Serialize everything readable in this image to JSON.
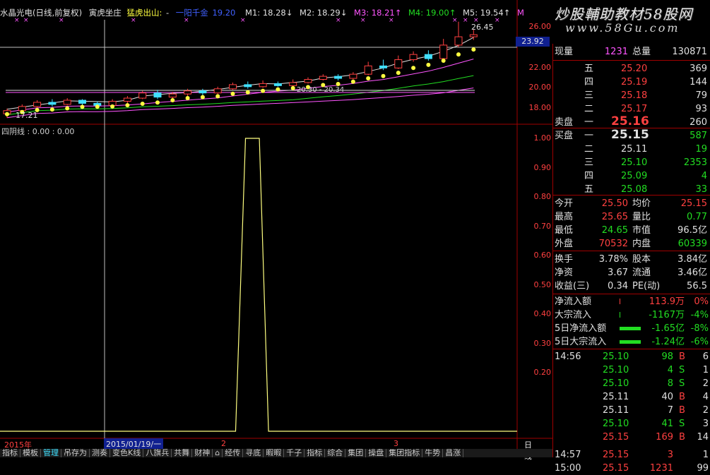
{
  "header": {
    "stock_title": "水晶光电(日线,前复权)",
    "signal1": "寅虎坐庄",
    "signal2": "猛虎出山:",
    "ind_sep": "-",
    "mline0": "一阳千金",
    "mline0_val": "19.20",
    "m1": "M1: 18.28↓",
    "m2": "M2: 18.29↓",
    "m3": "M3: 18.21↑",
    "m4": "M4: 19.00↑",
    "m5": "M5: 19.54↑",
    "m6": "M",
    "colors": {
      "title": "#e0e0e0",
      "signal1": "#e0e0e0",
      "signal2": "#ffff40",
      "m0": "#4060ff",
      "m1": "#e0e0e0",
      "m2": "#e0e0e0",
      "m3": "#ff55ff",
      "m4": "#22dd22",
      "m5": "#e0e0e0"
    }
  },
  "watermark": {
    "line1": "炒股輔助教材58股网",
    "line2": "www.58Gu.com"
  },
  "price_axis": {
    "ticks": [
      "26.00",
      "24.00",
      "22.00",
      "20.00",
      "18.00"
    ],
    "current": "23.92"
  },
  "annotations": {
    "high": "26.45",
    "low": "17.21",
    "mid": "20.30 - 20.34"
  },
  "indicator": {
    "label": "四阴线 : 0.00 : 0.00",
    "ticks": [
      "1.00",
      "0.90",
      "0.80",
      "0.70",
      "0.60",
      "0.50",
      "0.40",
      "0.30",
      "0.20"
    ],
    "spike": {
      "start_index": 15,
      "end_index": 17,
      "value": 1.0
    }
  },
  "x_axis": {
    "year": "2015年",
    "date_cursor": "2015/01/19/一",
    "m2": "2",
    "m3": "3",
    "period": "日线"
  },
  "chart_data": {
    "type": "candlestick",
    "candles": [
      {
        "o": 17.6,
        "c": 17.9,
        "h": 18.1,
        "l": 17.21
      },
      {
        "o": 17.9,
        "c": 18.3,
        "h": 18.5,
        "l": 17.8
      },
      {
        "o": 18.3,
        "c": 18.7,
        "h": 18.9,
        "l": 18.1
      },
      {
        "o": 18.7,
        "c": 18.5,
        "h": 19.0,
        "l": 18.3
      },
      {
        "o": 18.5,
        "c": 18.9,
        "h": 19.1,
        "l": 18.4
      },
      {
        "o": 18.9,
        "c": 18.6,
        "h": 19.0,
        "l": 18.3
      },
      {
        "o": 18.6,
        "c": 18.4,
        "h": 18.8,
        "l": 18.1
      },
      {
        "o": 18.4,
        "c": 18.8,
        "h": 19.0,
        "l": 18.3
      },
      {
        "o": 18.8,
        "c": 19.1,
        "h": 19.3,
        "l": 18.6
      },
      {
        "o": 19.1,
        "c": 19.6,
        "h": 19.8,
        "l": 19.0
      },
      {
        "o": 19.6,
        "c": 19.2,
        "h": 19.9,
        "l": 19.0
      },
      {
        "o": 19.2,
        "c": 19.5,
        "h": 19.7,
        "l": 19.0
      },
      {
        "o": 19.5,
        "c": 19.8,
        "h": 20.0,
        "l": 19.3
      },
      {
        "o": 19.8,
        "c": 19.6,
        "h": 20.0,
        "l": 19.4
      },
      {
        "o": 19.6,
        "c": 20.0,
        "h": 20.2,
        "l": 19.5
      },
      {
        "o": 20.0,
        "c": 20.4,
        "h": 20.6,
        "l": 19.9
      },
      {
        "o": 20.4,
        "c": 20.2,
        "h": 20.7,
        "l": 20.0
      },
      {
        "o": 20.2,
        "c": 20.5,
        "h": 20.8,
        "l": 20.1
      },
      {
        "o": 20.5,
        "c": 20.3,
        "h": 20.7,
        "l": 20.2
      },
      {
        "o": 20.3,
        "c": 20.6,
        "h": 20.9,
        "l": 20.2
      },
      {
        "o": 20.6,
        "c": 20.9,
        "h": 21.1,
        "l": 20.5
      },
      {
        "o": 20.9,
        "c": 21.2,
        "h": 21.4,
        "l": 20.8
      },
      {
        "o": 21.2,
        "c": 21.0,
        "h": 21.4,
        "l": 20.8
      },
      {
        "o": 21.0,
        "c": 21.4,
        "h": 21.6,
        "l": 20.9
      },
      {
        "o": 21.4,
        "c": 22.2,
        "h": 22.6,
        "l": 21.3
      },
      {
        "o": 22.2,
        "c": 22.0,
        "h": 22.8,
        "l": 21.8
      },
      {
        "o": 22.0,
        "c": 22.8,
        "h": 23.2,
        "l": 21.9
      },
      {
        "o": 22.8,
        "c": 23.3,
        "h": 23.6,
        "l": 22.6
      },
      {
        "o": 23.3,
        "c": 22.9,
        "h": 23.7,
        "l": 22.7
      },
      {
        "o": 22.9,
        "c": 24.2,
        "h": 24.8,
        "l": 22.8
      },
      {
        "o": 24.2,
        "c": 25.0,
        "h": 26.45,
        "l": 24.0
      },
      {
        "o": 25.0,
        "c": 25.2,
        "h": 25.7,
        "l": 24.7
      }
    ],
    "ylim": [
      17,
      26.5
    ]
  },
  "quote": {
    "now_vol_label": "现量",
    "now_vol": "1231",
    "total_vol_label": "总量",
    "total_vol": "130871",
    "sells": [
      {
        "label": "五",
        "price": "25.20",
        "vol": "369"
      },
      {
        "label": "四",
        "price": "25.19",
        "vol": "144"
      },
      {
        "label": "三",
        "price": "25.18",
        "vol": "79"
      },
      {
        "label": "二",
        "price": "25.17",
        "vol": "93"
      },
      {
        "label": "卖盘 一",
        "price": "25.16",
        "vol": "260"
      }
    ],
    "buys": [
      {
        "label": "买盘 一",
        "price": "25.15",
        "vol": "587"
      },
      {
        "label": "二",
        "price": "25.11",
        "vol": "19"
      },
      {
        "label": "三",
        "price": "25.10",
        "vol": "2353"
      },
      {
        "label": "四",
        "price": "25.09",
        "vol": "4"
      },
      {
        "label": "五",
        "price": "25.08",
        "vol": "33"
      }
    ],
    "stats": [
      {
        "l1": "今开",
        "v1": "25.50",
        "l2": "均价",
        "v2": "25.15",
        "c1": "r",
        "c2": "r"
      },
      {
        "l1": "最高",
        "v1": "25.65",
        "l2": "量比",
        "v2": "0.77",
        "c1": "r",
        "c2": "g"
      },
      {
        "l1": "最低",
        "v1": "24.65",
        "l2": "市值",
        "v2": "96.5亿",
        "c1": "g",
        "c2": "w"
      },
      {
        "l1": "外盘",
        "v1": "70532",
        "l2": "内盘",
        "v2": "60339",
        "c1": "r",
        "c2": "g"
      }
    ],
    "stats2": [
      {
        "l1": "换手",
        "v1": "3.78%",
        "l2": "股本",
        "v2": "3.84亿"
      },
      {
        "l1": "净资",
        "v1": "3.67",
        "l2": "流通",
        "v2": "3.46亿"
      },
      {
        "l1": "收益(三)",
        "v1": "0.34",
        "l2": "PE(动)",
        "v2": "56.5"
      }
    ],
    "flows": [
      {
        "label": "净流入额",
        "val": "113.9万",
        "pct": "0%",
        "c": "r",
        "bar": 0
      },
      {
        "label": "大宗流入",
        "val": "-1167万",
        "pct": "-4%",
        "c": "g",
        "bar": 0
      },
      {
        "label": "5日净流入额",
        "val": "-1.65亿",
        "pct": "-8%",
        "c": "g",
        "bar": 1
      },
      {
        "label": "5日大宗流入",
        "val": "-1.24亿",
        "pct": "-6%",
        "c": "g",
        "bar": 1
      }
    ],
    "ticks": [
      {
        "t": "14:56",
        "p": "25.10",
        "v": "98",
        "s": "B",
        "n": "6",
        "pc": "g",
        "sc": "r"
      },
      {
        "t": "",
        "p": "25.10",
        "v": "4",
        "s": "S",
        "n": "1",
        "pc": "g",
        "sc": "g"
      },
      {
        "t": "",
        "p": "25.10",
        "v": "8",
        "s": "S",
        "n": "2",
        "pc": "g",
        "sc": "g"
      },
      {
        "t": "",
        "p": "25.11",
        "v": "40",
        "s": "B",
        "n": "4",
        "pc": "w",
        "sc": "r"
      },
      {
        "t": "",
        "p": "25.11",
        "v": "7",
        "s": "B",
        "n": "2",
        "pc": "w",
        "sc": "r"
      },
      {
        "t": "",
        "p": "25.10",
        "v": "41",
        "s": "S",
        "n": "3",
        "pc": "g",
        "sc": "g"
      },
      {
        "t": "",
        "p": "25.15",
        "v": "169",
        "s": "B",
        "n": "14",
        "pc": "r",
        "sc": "r"
      },
      {
        "t": "14:57",
        "p": "25.15",
        "v": "3",
        "s": "",
        "n": "1",
        "pc": "r",
        "sc": "r"
      },
      {
        "t": "15:00",
        "p": "25.15",
        "v": "1231",
        "s": "",
        "n": "99",
        "pc": "r",
        "sc": "r"
      }
    ]
  },
  "tabs": [
    "指标",
    "模板",
    "管理",
    "吊存为",
    "测奏",
    "变色K线",
    "八旗兵",
    "共舞",
    "财神",
    "⌂",
    "经传",
    "寻底",
    "暇暇",
    "千子",
    "指标",
    "综合",
    "集团",
    "操盘",
    "集团指标",
    "牛势",
    "昌涨"
  ]
}
